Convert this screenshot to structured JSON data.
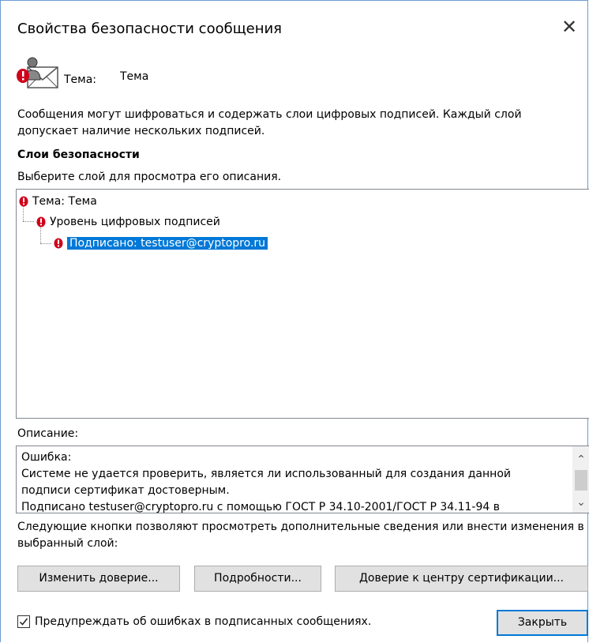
{
  "window": {
    "title": "Свойства безопасности сообщения",
    "close_glyph": "✕"
  },
  "header": {
    "icon": "secure-message-icon",
    "subject_label": "Тема:",
    "subject_value": "Тема"
  },
  "intro_text": "Сообщения могут шифроваться и содержать слои цифровых подписей. Каждый слой допускает наличие нескольких подписей.",
  "layers": {
    "heading": "Слои безопасности",
    "hint": "Выберите слой для просмотра его описания.",
    "tree": [
      {
        "label": "Тема: Тема",
        "icon": "error-icon",
        "selected": false
      },
      {
        "label": "Уровень цифровых подписей",
        "icon": "error-icon",
        "selected": false
      },
      {
        "label": "Подписано: testuser@cryptopro.ru",
        "icon": "error-icon",
        "selected": true
      }
    ]
  },
  "description": {
    "label": "Описание:",
    "lines": [
      "Ошибка:",
      "Системе не удается проверить, является ли использованный для создания данной",
      "подписи сертификат достоверным.",
      "Подписано testuser@cryptopro.ru с помощью ГОСТ Р 34.10-2001/ГОСТ Р 34.11-94 в"
    ]
  },
  "buttons_note": "Следующие кнопки позволяют просмотреть дополнительные сведения или внести изменения в выбранный слой:",
  "buttons": {
    "edit_trust": "Изменить доверие...",
    "details": "Подробности...",
    "ca_trust": "Доверие к центру сертификации...",
    "close": "Закрыть"
  },
  "warn_checkbox": {
    "label": "Предупреждать об ошибках в подписанных сообщениях.",
    "checked": true
  },
  "colors": {
    "selection": "#0078d7",
    "error": "#d0021b",
    "button_face": "#e1e1e1"
  }
}
